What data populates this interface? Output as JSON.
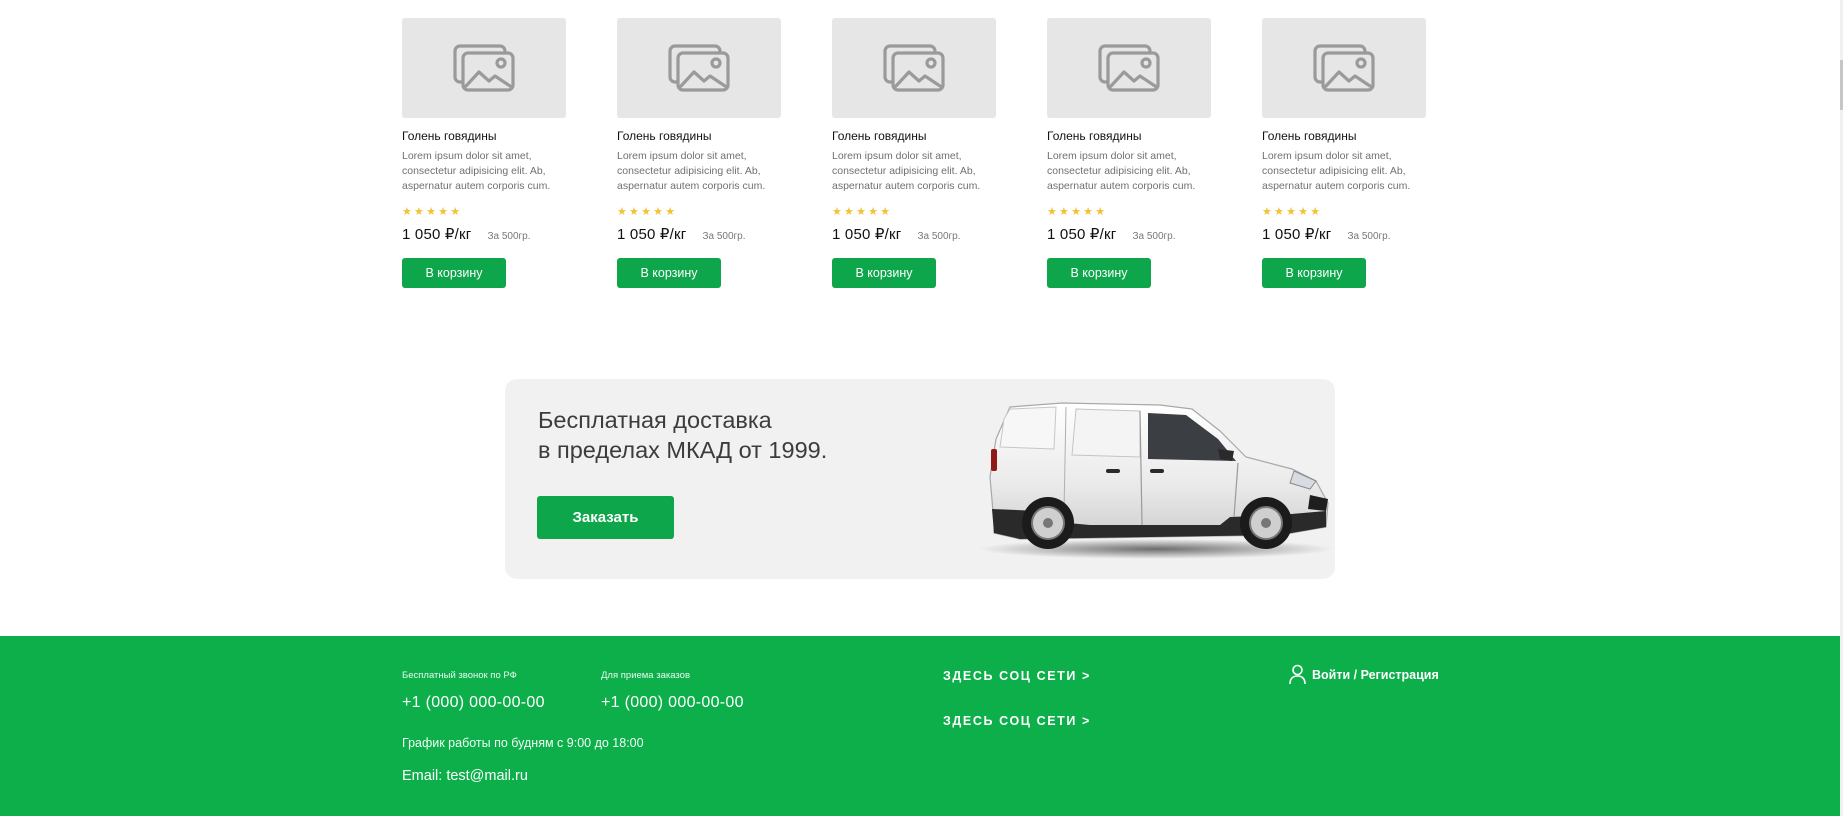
{
  "products": [
    {
      "name": "Голень говядины",
      "description": "Lorem ipsum dolor sit amet, consectetur adipisicing elit. Ab, aspernatur autem corporis cum.",
      "rating": 5,
      "stars": "★★★★★",
      "price": "1 050 ₽/кг",
      "unit": "За 500гр.",
      "button": "В корзину"
    },
    {
      "name": "Голень говядины",
      "description": "Lorem ipsum dolor sit amet, consectetur adipisicing elit. Ab, aspernatur autem corporis cum.",
      "rating": 5,
      "stars": "★★★★★",
      "price": "1 050 ₽/кг",
      "unit": "За 500гр.",
      "button": "В корзину"
    },
    {
      "name": "Голень говядины",
      "description": "Lorem ipsum dolor sit amet, consectetur adipisicing elit. Ab, aspernatur autem corporis cum.",
      "rating": 5,
      "stars": "★★★★★",
      "price": "1 050 ₽/кг",
      "unit": "За 500гр.",
      "button": "В корзину"
    },
    {
      "name": "Голень говядины",
      "description": "Lorem ipsum dolor sit amet, consectetur adipisicing elit. Ab, aspernatur autem corporis cum.",
      "rating": 5,
      "stars": "★★★★★",
      "price": "1 050 ₽/кг",
      "unit": "За 500гр.",
      "button": "В корзину"
    },
    {
      "name": "Голень говядины",
      "description": "Lorem ipsum dolor sit amet, consectetur adipisicing elit. Ab, aspernatur autem corporis cum.",
      "rating": 5,
      "stars": "★★★★★",
      "price": "1 050 ₽/кг",
      "unit": "За 500гр.",
      "button": "В корзину"
    }
  ],
  "banner": {
    "title_line1": "Бесплатная доставка",
    "title_line2": "в пределах МКАД от 1999.",
    "cta": "Заказать",
    "image_icon": "delivery-van"
  },
  "footer": {
    "free_call_label": "Бесплатный звонок по РФ",
    "free_call_phone": "+1 (000) 000-00-00",
    "orders_label": "Для приема заказов",
    "orders_phone": "+1 (000) 000-00-00",
    "hours": "График работы по будням с 9:00 до 18:00",
    "email": "Email: test@mail.ru",
    "social_1": "ЗДЕСЬ СОЦ СЕТИ >",
    "social_2": "ЗДЕСЬ СОЦ СЕТИ >",
    "login": "Войти / Регистрация"
  },
  "colors": {
    "accent_green": "#0da64a",
    "footer_green": "#0daf4b",
    "star_yellow": "#f2c233",
    "placeholder_gray": "#e6e6e6",
    "banner_bg": "#f1f1f1"
  },
  "icons": {
    "product_image": "image-placeholder-icon",
    "user": "user-icon"
  }
}
